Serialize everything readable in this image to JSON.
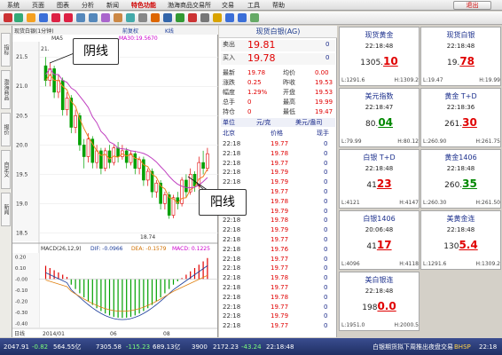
{
  "menu": {
    "items": [
      "系统",
      "页面",
      "图表",
      "分析",
      "新闻",
      "特色功能",
      "渤海商品交易所",
      "交易",
      "工具",
      "帮助"
    ],
    "hot_index": 5,
    "logout": "退出"
  },
  "side_tabs": [
    "指标",
    "渤海商品",
    "报价",
    "自定义",
    "新闻"
  ],
  "chart": {
    "title": "现货白银(1分钟)",
    "ma5": "MA5",
    "ma30": "MA30:19.5670",
    "ma30b": "MA30:19.56",
    "mode": "前复权",
    "tab_k": "K线",
    "yticks": [
      "21.5",
      "21.0",
      "20.5",
      "20.0",
      "19.5",
      "19.0",
      "18.5"
    ],
    "high_label": "21.",
    "low_label": "18.74",
    "macd": {
      "title": "MACD(26,12,9)",
      "dif": "DIF: -0.0966",
      "dea": "DEA: -0.1579",
      "macd": "MACD: 0.1225",
      "yticks": [
        "0.20",
        "0.10",
        "-0.00",
        "-0.10",
        "-0.20",
        "-0.30",
        "-0.40"
      ]
    },
    "xlabels": [
      "日线",
      "2014/01",
      "06",
      "08"
    ]
  },
  "callouts": {
    "yin": "阴线",
    "yang": "阳线"
  },
  "quote": {
    "title": "现货白银(AG)",
    "sell_label": "卖出",
    "sell": "19.81",
    "sell_qty": "0",
    "buy_label": "买入",
    "buy": "19.78",
    "buy_qty": "0",
    "rows": [
      [
        "最新",
        "19.78",
        "均价",
        "0.00"
      ],
      [
        "涨跌",
        "0.25",
        "昨收",
        "19.53"
      ],
      [
        "幅度",
        "1.29%",
        "开盘",
        "19.53"
      ],
      [
        "总手",
        "0",
        "最高",
        "19.99"
      ],
      [
        "持仓",
        "0",
        "最低",
        "19.47"
      ]
    ],
    "unit_label": "单位",
    "unit": "元/克",
    "unit2": "美元/盎司",
    "tick_header": [
      "北京",
      "价格",
      "现手"
    ],
    "ticks": [
      [
        "22:18",
        "19.77",
        "0"
      ],
      [
        "22:18",
        "19.78",
        "0"
      ],
      [
        "22:18",
        "19.77",
        "0"
      ],
      [
        "22:18",
        "19.79",
        "0"
      ],
      [
        "22:18",
        "19.79",
        "0"
      ],
      [
        "22:18",
        "19.77",
        "0"
      ],
      [
        "22:18",
        "19.78",
        "0"
      ],
      [
        "22:18",
        "19.79",
        "0"
      ],
      [
        "22:18",
        "19.78",
        "0"
      ],
      [
        "22:18",
        "19.79",
        "0"
      ],
      [
        "22:18",
        "19.77",
        "0"
      ],
      [
        "22:18",
        "19.76",
        "0"
      ],
      [
        "22:18",
        "19.77",
        "0"
      ],
      [
        "22:18",
        "19.77",
        "0"
      ],
      [
        "22:18",
        "19.78",
        "0"
      ],
      [
        "22:18",
        "19.77",
        "0"
      ],
      [
        "22:18",
        "19.78",
        "0"
      ],
      [
        "22:18",
        "19.77",
        "0"
      ],
      [
        "22:18",
        "19.79",
        "0"
      ],
      [
        "22:18",
        "19.77",
        "0"
      ]
    ]
  },
  "grid": [
    {
      "name": "现货黄金",
      "time": "22:18:48",
      "val_a": "1305.",
      "val_b": "10",
      "color": "r",
      "l": "L:1291.6",
      "h": "H:1309.2"
    },
    {
      "name": "现货白银",
      "time": "22:18:48",
      "val_a": "19.",
      "val_b": "78",
      "color": "r",
      "l": "L:19.47",
      "h": "H:19.99"
    },
    {
      "name": "美元指数",
      "time": "22:18:47",
      "val_a": "80.",
      "val_b": "04",
      "color": "g",
      "l": "L:79.99",
      "h": "H:80.12"
    },
    {
      "name": "黄金 T+D",
      "time": "22:18:36",
      "val_a": "261.",
      "val_b": "30",
      "color": "r",
      "l": "L:260.90",
      "h": "H:261.75"
    },
    {
      "name": "白银 T+D",
      "time": "22:18:48",
      "val_a": "41",
      "val_b": "23",
      "color": "r",
      "l": "L:4121",
      "h": "H:4147"
    },
    {
      "name": "黄金1406",
      "time": "22:18:48",
      "val_a": "260.",
      "val_b": "35",
      "color": "g",
      "l": "L:260.30",
      "h": "H:261.50"
    },
    {
      "name": "白银1406",
      "time": "20:06:48",
      "val_a": "41",
      "val_b": "17",
      "color": "r",
      "l": "L:4096",
      "h": "H:4118"
    },
    {
      "name": "美黄金连",
      "time": "22:18:48",
      "val_a": "130",
      "val_b": "5.4",
      "color": "r",
      "l": "L:1291.6",
      "h": "H:1309.2"
    },
    {
      "name": "美白银连",
      "time": "22:18:48",
      "val_a": "198",
      "val_b": "0.0",
      "color": "r",
      "l": "L:1951.0",
      "h": "H:2000.5"
    }
  ],
  "status": {
    "items": [
      "2047.91",
      "-0.82",
      "564.55亿",
      "7305.58",
      "-115.23",
      "689.13亿",
      "3900",
      "2172.23",
      "-43.24",
      "22:18:48"
    ],
    "ticker": "白银期货拟下周推出夜盘交易",
    "brand": "BHSP",
    "clock": "22:18"
  }
}
